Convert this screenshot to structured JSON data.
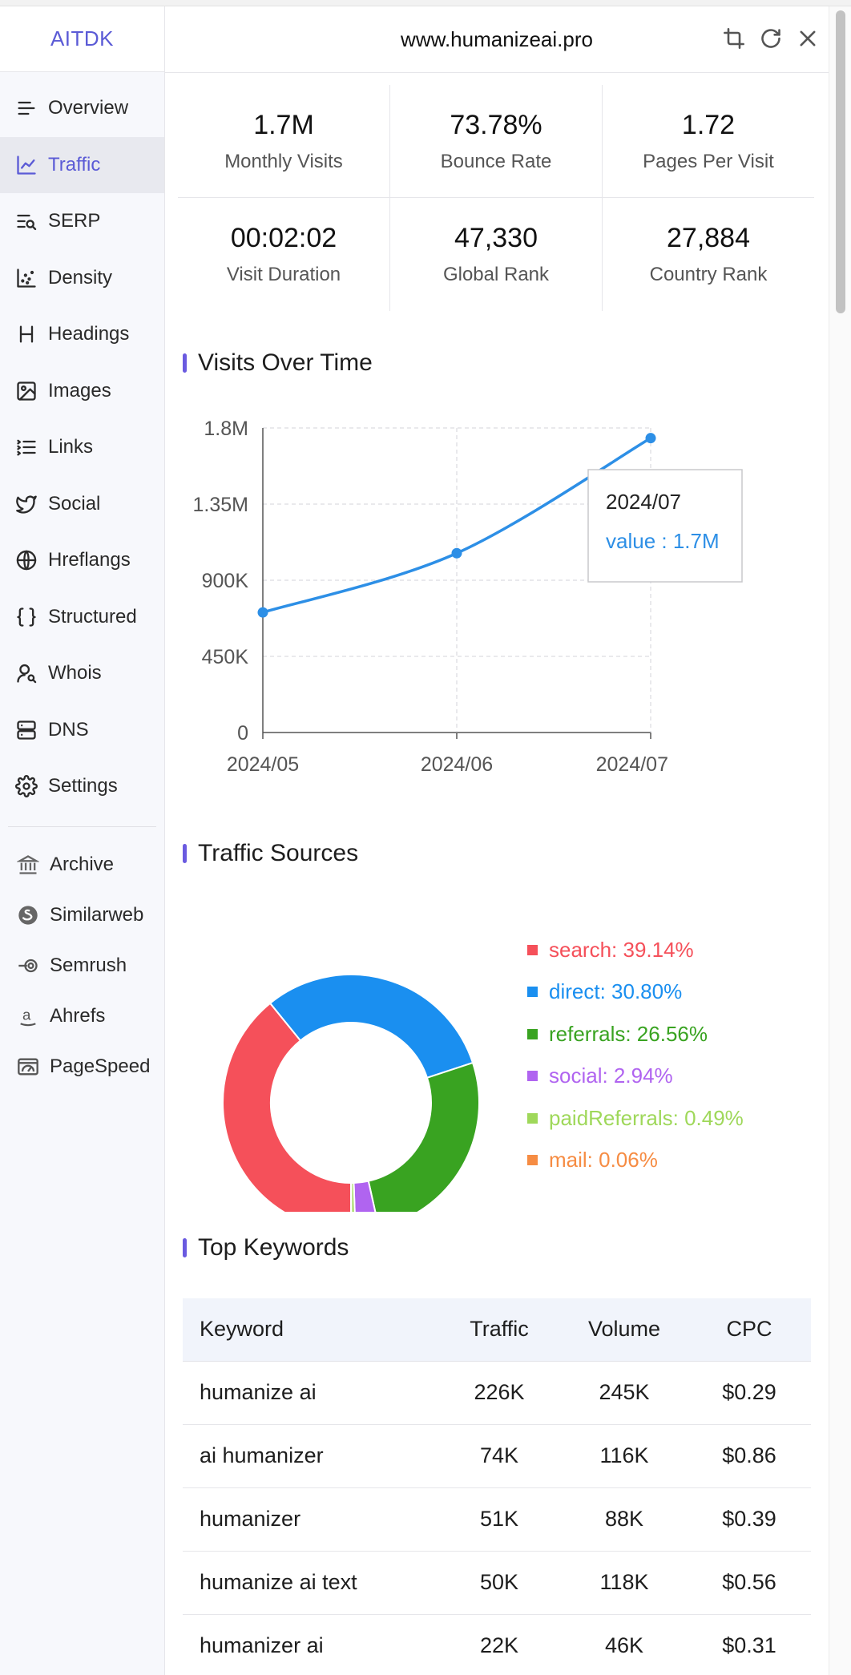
{
  "brand": "AITDK",
  "header": {
    "site": "www.humanizeai.pro"
  },
  "sidebar": {
    "items": [
      {
        "label": "Overview",
        "icon": "overview-icon"
      },
      {
        "label": "Traffic",
        "icon": "traffic-icon",
        "active": true
      },
      {
        "label": "SERP",
        "icon": "serp-icon"
      },
      {
        "label": "Density",
        "icon": "density-icon"
      },
      {
        "label": "Headings",
        "icon": "heading-icon"
      },
      {
        "label": "Images",
        "icon": "image-icon"
      },
      {
        "label": "Links",
        "icon": "links-icon"
      },
      {
        "label": "Social",
        "icon": "twitter-icon"
      },
      {
        "label": "Hreflangs",
        "icon": "globe-icon"
      },
      {
        "label": "Structured",
        "icon": "braces-icon"
      },
      {
        "label": "Whois",
        "icon": "user-search-icon"
      },
      {
        "label": "DNS",
        "icon": "server-icon"
      },
      {
        "label": "Settings",
        "icon": "gear-icon"
      }
    ],
    "external": [
      {
        "label": "Archive",
        "icon": "archive-icon"
      },
      {
        "label": "Similarweb",
        "icon": "similarweb-icon"
      },
      {
        "label": "Semrush",
        "icon": "semrush-icon"
      },
      {
        "label": "Ahrefs",
        "icon": "ahrefs-icon"
      },
      {
        "label": "PageSpeed",
        "icon": "pagespeed-icon"
      }
    ]
  },
  "stats": [
    {
      "value": "1.7M",
      "label": "Monthly Visits"
    },
    {
      "value": "73.78%",
      "label": "Bounce Rate"
    },
    {
      "value": "1.72",
      "label": "Pages Per Visit"
    },
    {
      "value": "00:02:02",
      "label": "Visit Duration"
    },
    {
      "value": "47,330",
      "label": "Global Rank"
    },
    {
      "value": "27,884",
      "label": "Country Rank"
    }
  ],
  "sections": {
    "visits": "Visits Over Time",
    "sources": "Traffic Sources",
    "keywords": "Top Keywords"
  },
  "chart_data": [
    {
      "type": "line",
      "title": "Visits Over Time",
      "x": [
        "2024/05",
        "2024/06",
        "2024/07"
      ],
      "values": [
        710000,
        1060000,
        1740000
      ],
      "ylim": [
        0,
        1800000
      ],
      "yticks": [
        "0",
        "450K",
        "900K",
        "1.35M",
        "1.8M"
      ],
      "grid": true,
      "color": "#2d8fe6",
      "tooltip": {
        "title": "2024/07",
        "text": "value : 1.7M"
      }
    },
    {
      "type": "pie",
      "title": "Traffic Sources",
      "donut": true,
      "legend_position": "right",
      "slices": [
        {
          "name": "search",
          "value": 39.14,
          "label": "search: 39.14%",
          "color": "#f5505a"
        },
        {
          "name": "direct",
          "value": 30.8,
          "label": "direct: 30.80%",
          "color": "#1a8ff0"
        },
        {
          "name": "referrals",
          "value": 26.56,
          "label": "referrals: 26.56%",
          "color": "#39a321"
        },
        {
          "name": "social",
          "value": 2.94,
          "label": "social: 2.94%",
          "color": "#b064f0"
        },
        {
          "name": "paidReferrals",
          "value": 0.49,
          "label": "paidReferrals: 0.49%",
          "color": "#9fd85a"
        },
        {
          "name": "mail",
          "value": 0.06,
          "label": "mail: 0.06%",
          "color": "#f68c43"
        }
      ]
    }
  ],
  "keywords": {
    "headers": [
      "Keyword",
      "Traffic",
      "Volume",
      "CPC"
    ],
    "rows": [
      [
        "humanize ai",
        "226K",
        "245K",
        "$0.29"
      ],
      [
        "ai humanizer",
        "74K",
        "116K",
        "$0.86"
      ],
      [
        "humanizer",
        "51K",
        "88K",
        "$0.39"
      ],
      [
        "humanize ai text",
        "50K",
        "118K",
        "$0.56"
      ],
      [
        "humanizer ai",
        "22K",
        "46K",
        "$0.31"
      ]
    ]
  }
}
